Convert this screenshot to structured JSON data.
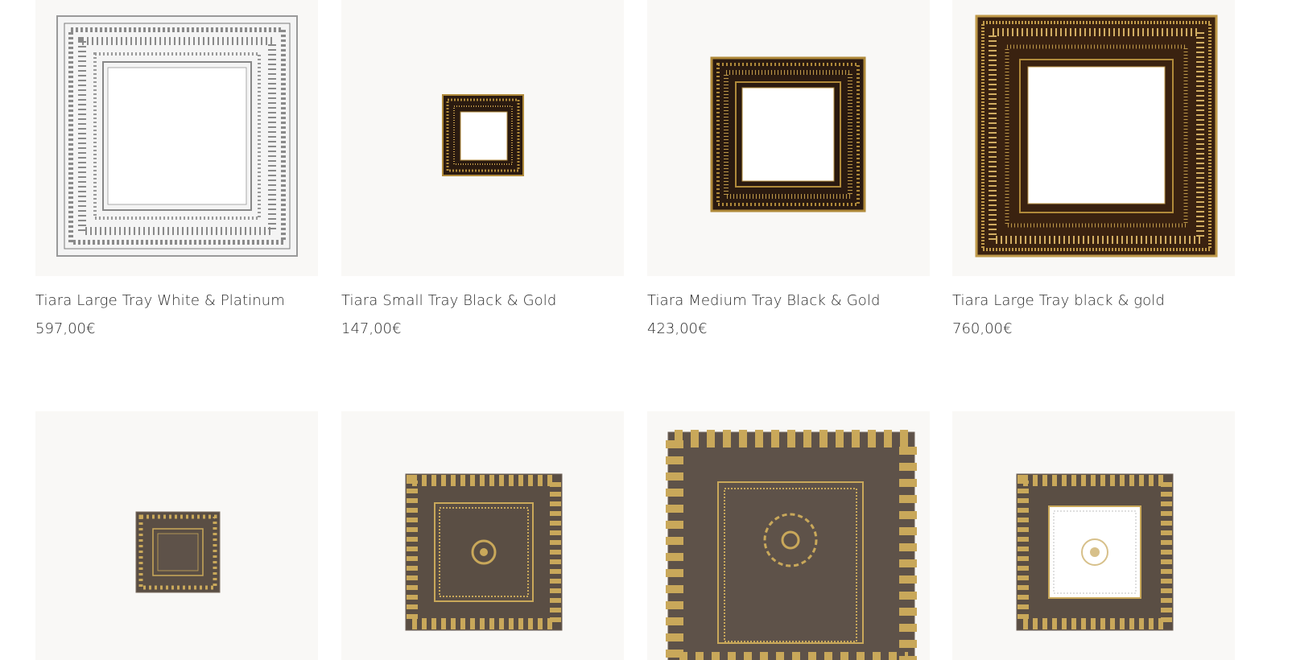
{
  "products": [
    {
      "name": "Tiara  Large Tray White &  Platinum",
      "price": "597,00€",
      "image": "tiara-large-tray-white-platinum",
      "colors": {
        "frame": "#f2f2f2",
        "pattern": "#8a8a8a",
        "center": "#ffffff"
      }
    },
    {
      "name": "Tiara Small Tray  Black & Gold",
      "price": "147,00€",
      "image": "tiara-small-tray-black-gold",
      "colors": {
        "frame": "#2a1a10",
        "pattern": "#b08a3a",
        "center": "#ffffff"
      }
    },
    {
      "name": "Tiara  Medium Tray  Black & Gold",
      "price": "423,00€",
      "image": "tiara-medium-tray-black-gold",
      "colors": {
        "frame": "#2a1a10",
        "pattern": "#b08a3a",
        "center": "#ffffff"
      }
    },
    {
      "name": "Tiara  Large Tray black & gold",
      "price": "760,00€",
      "image": "tiara-large-tray-black-gold",
      "colors": {
        "frame": "#3a2210",
        "pattern": "#c09a4a",
        "center": "#ffffff"
      }
    },
    {
      "name": "",
      "price": "",
      "image": "brown-gold-small-tray",
      "colors": {
        "frame": "#5a4e44",
        "pattern": "#c9a85a",
        "center": "#5a4e44"
      }
    },
    {
      "name": "",
      "price": "",
      "image": "brown-gold-medium-tray",
      "colors": {
        "frame": "#5a4e44",
        "pattern": "#c9a85a",
        "center": "#5a4e44"
      }
    },
    {
      "name": "",
      "price": "",
      "image": "brown-gold-large-tray",
      "colors": {
        "frame": "#5e5249",
        "pattern": "#c9a85a",
        "center": "#5e5249"
      }
    },
    {
      "name": "",
      "price": "",
      "image": "brown-gold-white-center-tray",
      "colors": {
        "frame": "#5a4e44",
        "pattern": "#c9a85a",
        "center": "#ffffff"
      }
    }
  ]
}
